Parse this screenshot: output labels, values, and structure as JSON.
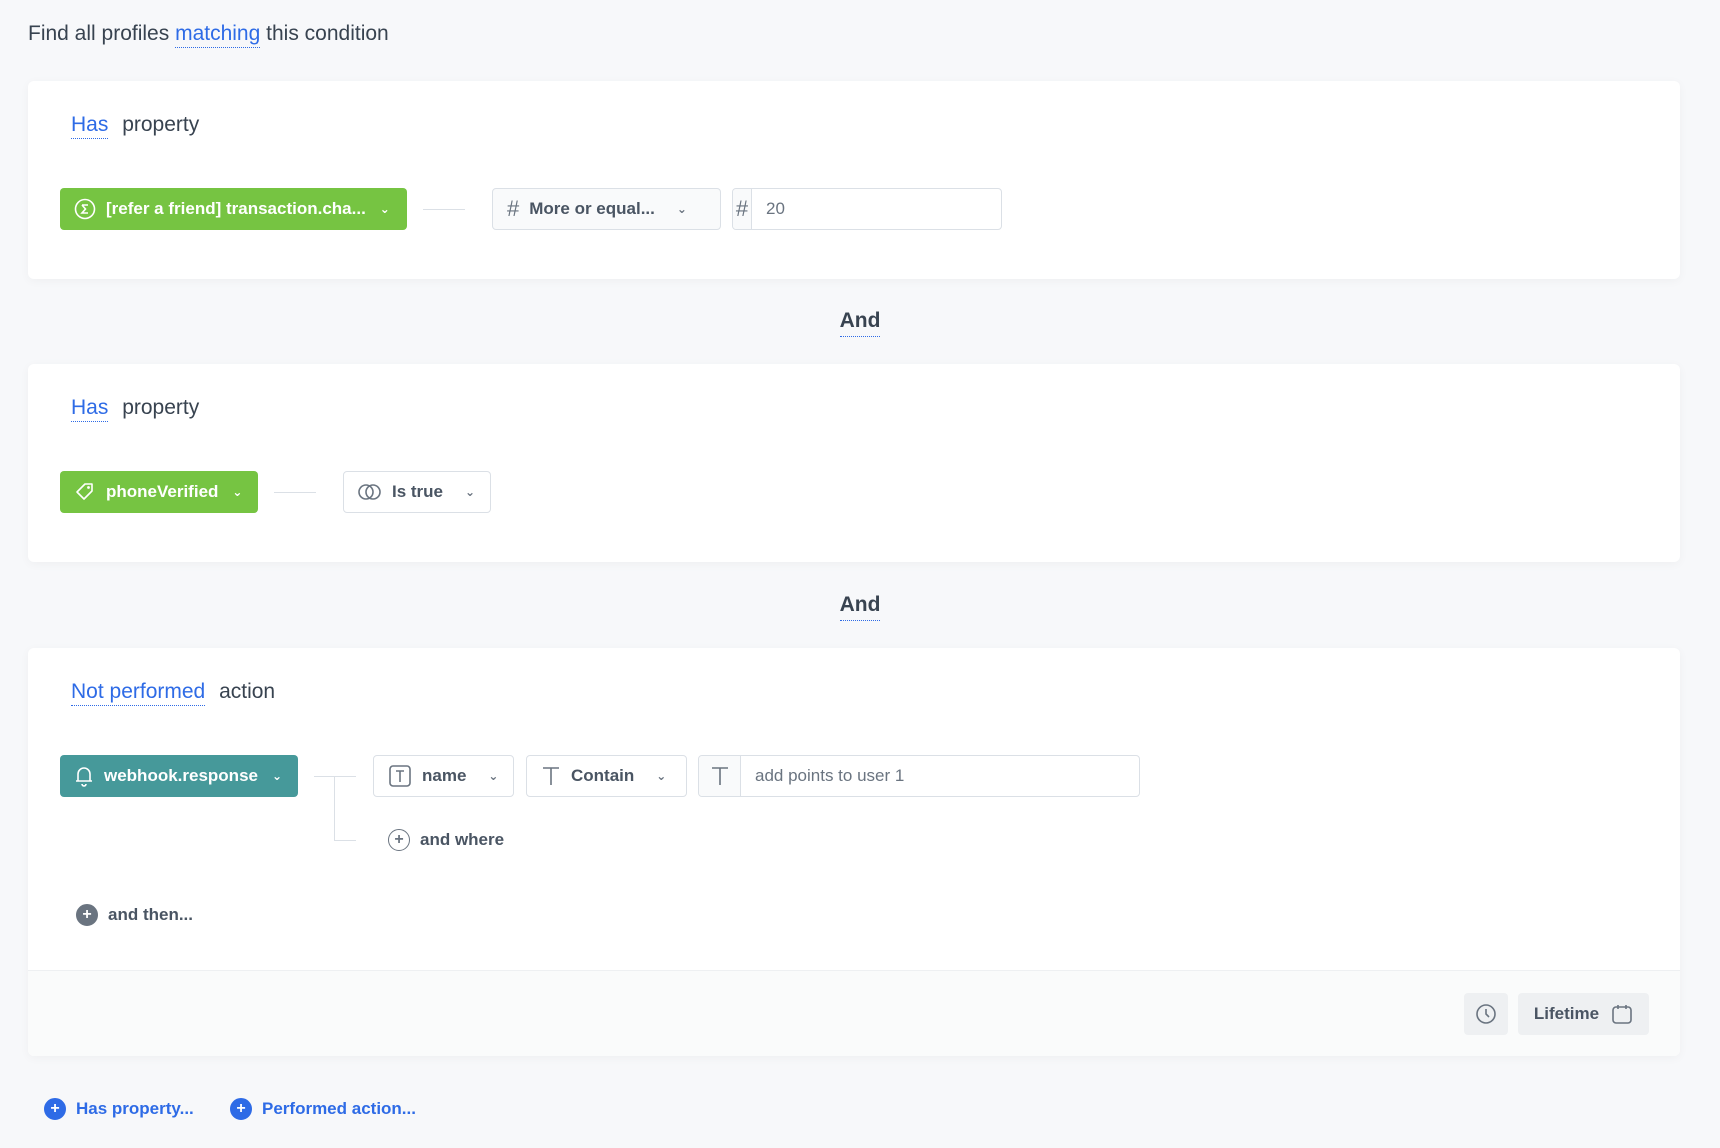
{
  "headline": {
    "prefix": "Find all profiles",
    "link": "matching",
    "suffix": "this condition"
  },
  "conditions": [
    {
      "qualifier": "Has",
      "type": "property",
      "chip": {
        "label": "[refer a friend] transaction.cha...",
        "icon": "sigma-icon",
        "color": "#76c442"
      },
      "operator": {
        "label": "More or equal...",
        "icon": "hash-icon"
      },
      "value": {
        "icon": "hash-icon",
        "value": "20"
      }
    },
    {
      "qualifier": "Has",
      "type": "property",
      "chip": {
        "label": "phoneVerified",
        "icon": "tag-icon",
        "color": "#76c442"
      },
      "operator": {
        "label": "Is true",
        "icon": "toggle-icon"
      }
    },
    {
      "qualifier": "Not performed",
      "type": "action",
      "chip": {
        "label": "webhook.response",
        "icon": "bell-icon",
        "color": "#46999a"
      },
      "param": {
        "label": "name",
        "icon": "text-box-icon"
      },
      "operator": {
        "label": "Contain",
        "icon": "text-icon"
      },
      "value": {
        "icon": "text-icon",
        "value": "add points to user 1"
      },
      "and_where": "and where",
      "and_then": "and then...",
      "time_range": {
        "label": "Lifetime"
      }
    }
  ],
  "connectors": [
    "And",
    "And"
  ],
  "bottom_actions": [
    {
      "label": "Has property..."
    },
    {
      "label": "Performed action..."
    }
  ],
  "colors": {
    "accent": "#2e6be6",
    "property_chip": "#76c442",
    "action_chip": "#46999a",
    "background": "#f7f8fa"
  }
}
